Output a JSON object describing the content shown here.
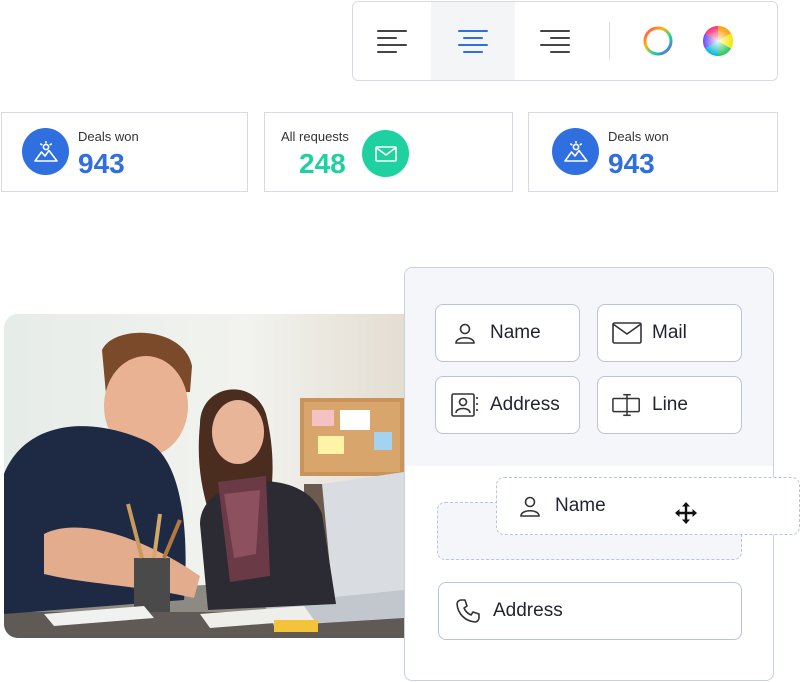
{
  "toolbar": {
    "buttons": [
      {
        "icon": "align-left-icon",
        "active": false
      },
      {
        "icon": "align-center-icon",
        "active": true
      },
      {
        "icon": "align-right-icon",
        "active": false
      }
    ],
    "colors": [
      {
        "icon": "color-ring-icon"
      },
      {
        "icon": "color-wheel-icon"
      }
    ],
    "active_color": "#2f6fe0"
  },
  "stats": [
    {
      "label": "Deals won",
      "value": "943",
      "icon": "landscape-icon",
      "color": "#2f6fe0"
    },
    {
      "label": "All requests",
      "value": "248",
      "icon": "mail-icon",
      "color": "#1fd1a0"
    },
    {
      "label": "Deals won",
      "value": "943",
      "icon": "landscape-icon",
      "color": "#2f6fe0"
    }
  ],
  "form_builder": {
    "fields": [
      {
        "label": "Name",
        "icon": "user-icon"
      },
      {
        "label": "Mail",
        "icon": "mail-icon"
      },
      {
        "label": "Address",
        "icon": "contact-card-icon"
      },
      {
        "label": "Line",
        "icon": "text-field-icon"
      }
    ],
    "dragging_field": {
      "label": "Name",
      "icon": "user-icon"
    },
    "bottom_field": {
      "label": "Address",
      "icon": "phone-icon"
    }
  }
}
